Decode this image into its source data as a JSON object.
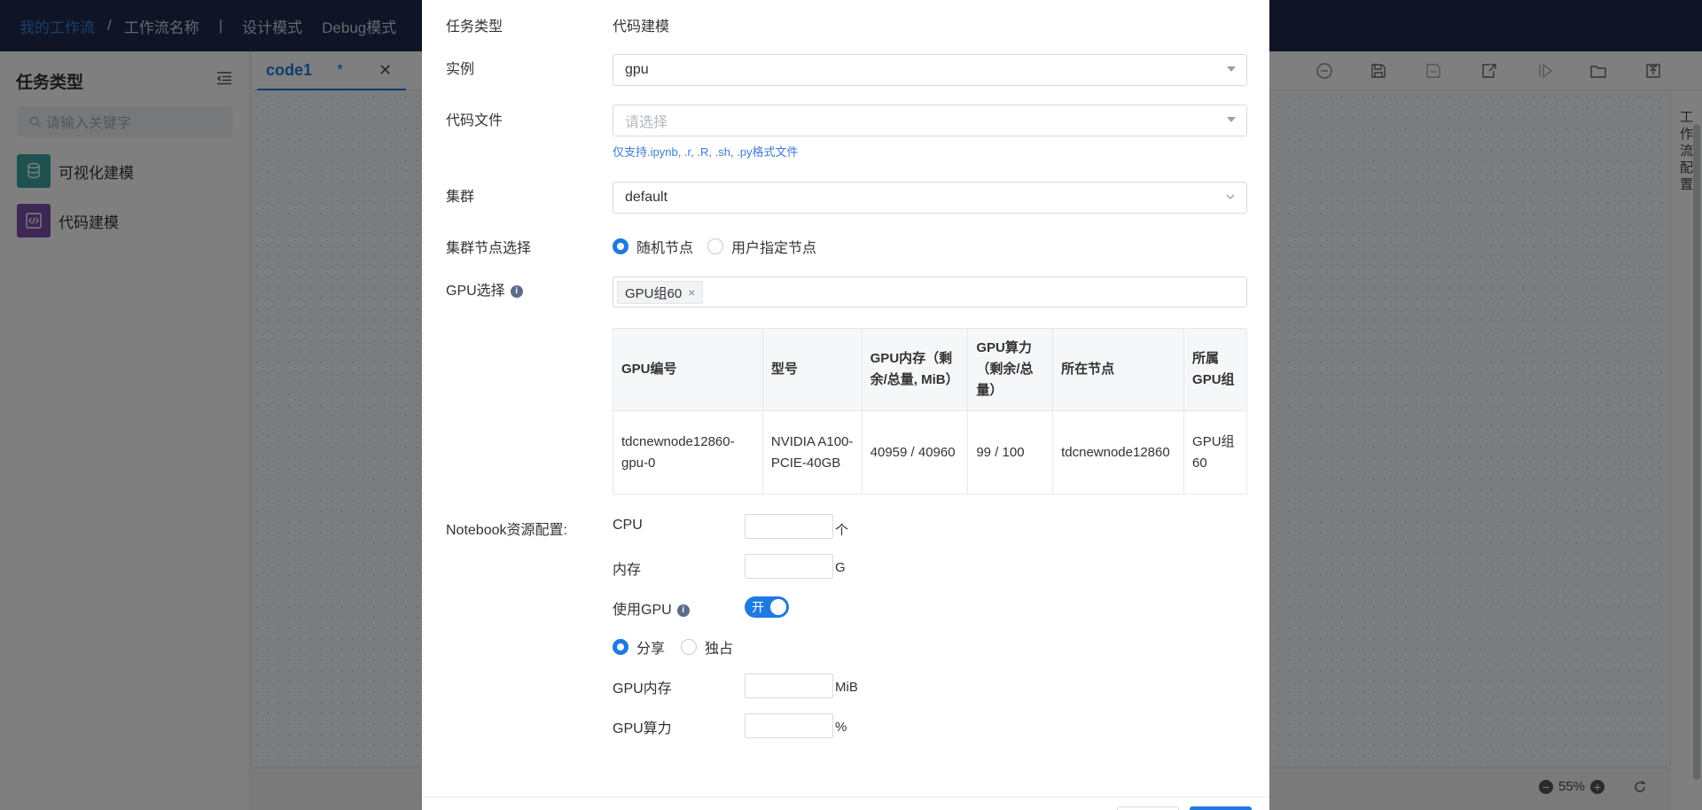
{
  "topbar": {
    "crumb_root": "我的工作流",
    "crumb_sep": "/",
    "crumb_current": "工作流名称",
    "divider": "|",
    "mode_design": "设计模式",
    "mode_debug": "Debug模式"
  },
  "sidebar": {
    "title": "任务类型",
    "search_placeholder": "请输入关键字",
    "items": [
      {
        "label": "可视化建模",
        "icon": "database-icon",
        "color": "#3aa5a0"
      },
      {
        "label": "代码建模",
        "icon": "code-icon",
        "color": "#7b4fa8"
      }
    ]
  },
  "tabs": [
    {
      "label": "code1",
      "modified": "*"
    }
  ],
  "right_panel": {
    "label": "工作流配置"
  },
  "zoom": {
    "level": "55%"
  },
  "form": {
    "task_type_label": "任务类型",
    "task_type_value": "代码建模",
    "instance_label": "实例",
    "instance_value": "gpu",
    "code_file_label": "代码文件",
    "code_file_placeholder": "请选择",
    "code_file_hint": "仅支持.ipynb, .r, .R, .sh, .py格式文件",
    "cluster_label": "集群",
    "cluster_value": "default",
    "node_select_label": "集群节点选择",
    "node_options": [
      "随机节点",
      "用户指定节点"
    ],
    "gpu_select_label": "GPU选择",
    "gpu_tags": [
      "GPU组60"
    ],
    "gpu_table": {
      "headers": [
        "GPU编号",
        "型号",
        "GPU内存（剩余/总量, MiB）",
        "GPU算力（剩余/总量）",
        "所在节点",
        "所属GPU组"
      ],
      "rows": [
        [
          "tdcnewnode12860-gpu-0",
          "NVIDIA A100-PCIE-40GB",
          "40959 / 40960",
          "99 / 100",
          "tdcnewnode12860",
          "GPU组60"
        ]
      ]
    },
    "notebook_label": "Notebook资源配置:",
    "cpu_label": "CPU",
    "cpu_unit": "个",
    "mem_label": "内存",
    "mem_unit": "G",
    "use_gpu_label": "使用GPU",
    "use_gpu_switch": "开",
    "gpu_mode_options": [
      "分享",
      "独占"
    ],
    "gpu_mem_label": "GPU内存",
    "gpu_mem_unit": "MiB",
    "gpu_power_label": "GPU算力",
    "gpu_power_unit": "%"
  },
  "colors": {
    "primary": "#1f7ae0",
    "topbar": "#1f2b4d"
  }
}
